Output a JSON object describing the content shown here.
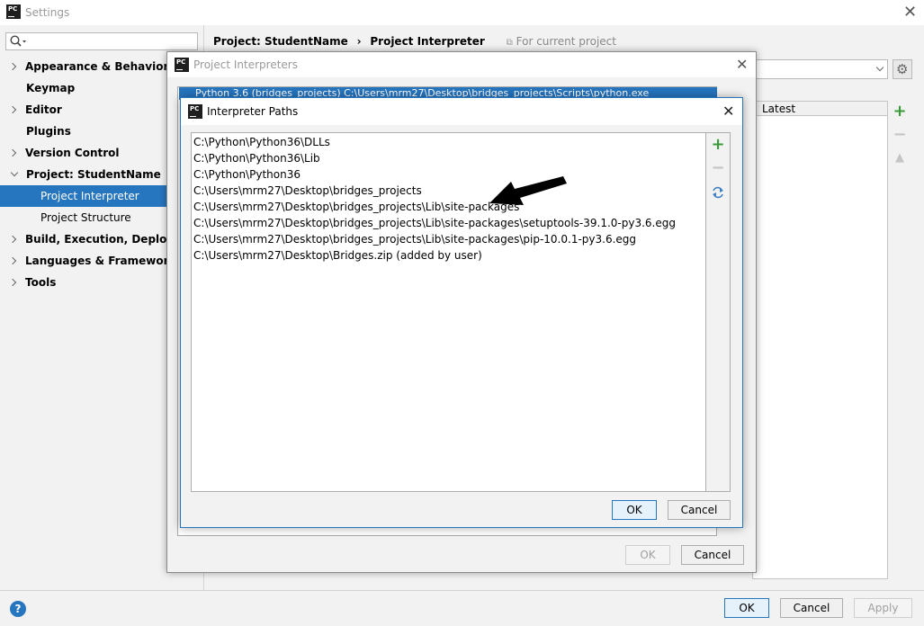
{
  "window": {
    "title": "Settings"
  },
  "search": {
    "placeholder": ""
  },
  "sidebar": {
    "items": [
      {
        "label": "Appearance & Behavior"
      },
      {
        "label": "Keymap"
      },
      {
        "label": "Editor"
      },
      {
        "label": "Plugins"
      },
      {
        "label": "Version Control"
      },
      {
        "label": "Project: StudentName"
      },
      {
        "label": "Project Interpreter"
      },
      {
        "label": "Project Structure"
      },
      {
        "label": "Build, Execution, Deployment"
      },
      {
        "label": "Languages & Frameworks"
      },
      {
        "label": "Tools"
      }
    ]
  },
  "breadcrumb": {
    "project": "Project: StudentName",
    "separator": "›",
    "page": "Project Interpreter",
    "scope": "For current project"
  },
  "packages_table": {
    "latest_header": "Latest"
  },
  "project_interpreters_dialog": {
    "title": "Project Interpreters",
    "selected_interpreter": "Python 3.6 (bridges_projects) C:\\Users\\mrm27\\Desktop\\bridges_projects\\Scripts\\python.exe",
    "ok_label": "OK",
    "cancel_label": "Cancel"
  },
  "interpreter_paths_dialog": {
    "title": "Interpreter Paths",
    "paths": [
      "C:\\Python\\Python36\\DLLs",
      "C:\\Python\\Python36\\Lib",
      "C:\\Python\\Python36",
      "C:\\Users\\mrm27\\Desktop\\bridges_projects",
      "C:\\Users\\mrm27\\Desktop\\bridges_projects\\Lib\\site-packages",
      "C:\\Users\\mrm27\\Desktop\\bridges_projects\\Lib\\site-packages\\setuptools-39.1.0-py3.6.egg",
      "C:\\Users\\mrm27\\Desktop\\bridges_projects\\Lib\\site-packages\\pip-10.0.1-py3.6.egg",
      "C:\\Users\\mrm27\\Desktop\\Bridges.zip  (added by user)"
    ],
    "ok_label": "OK",
    "cancel_label": "Cancel"
  },
  "footer": {
    "help_label": "?",
    "ok_label": "OK",
    "cancel_label": "Cancel",
    "apply_label": "Apply"
  },
  "colors": {
    "selection": "#2675bf",
    "add_green": "#3a9a3a",
    "refresh_blue": "#3c7fc4"
  }
}
